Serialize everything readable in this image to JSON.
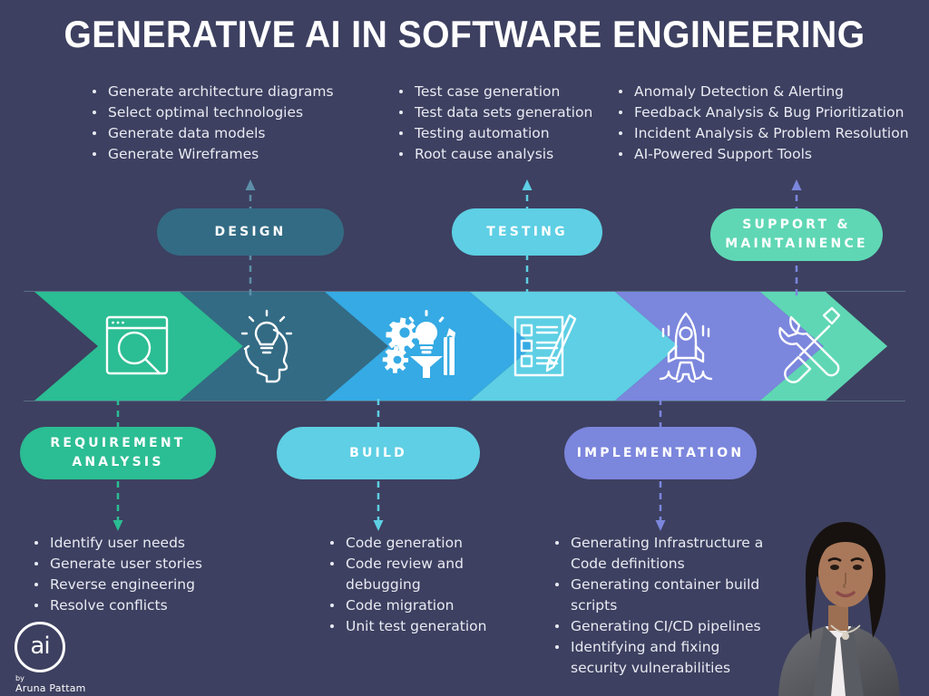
{
  "title": "GENERATIVE AI IN SOFTWARE ENGINEERING",
  "colors": {
    "background": "#3d4060",
    "requirement": "#2bbd93",
    "design": "#336b84",
    "build": "#35aae4",
    "testing": "#5ecfe4",
    "implementation": "#7b86dd",
    "support": "#5fd7b4",
    "text": "#e9eaf2"
  },
  "top_lists": [
    {
      "stage": "DESIGN",
      "items": [
        "Generate architecture diagrams",
        "Select optimal technologies",
        "Generate data models",
        "Generate Wireframes"
      ]
    },
    {
      "stage": "TESTING",
      "items": [
        "Test case generation",
        "Test data sets generation",
        "Testing automation",
        "Root cause analysis"
      ]
    },
    {
      "stage": "SUPPORT & MAINTAINENCE",
      "items": [
        "Anomaly Detection & Alerting",
        "Feedback Analysis & Bug Prioritization",
        "Incident Analysis & Problem Resolution",
        "AI-Powered Support Tools"
      ]
    }
  ],
  "bottom_lists": [
    {
      "stage": "REQUIREMENT ANALYSIS",
      "items": [
        "Identify user needs",
        "Generate user stories",
        "Reverse engineering",
        "Resolve conflicts"
      ]
    },
    {
      "stage": "BUILD",
      "items": [
        "Code generation",
        "Code review and debugging",
        "Code migration",
        "Unit test generation"
      ]
    },
    {
      "stage": "IMPLEMENTATION",
      "items": [
        "Generating Infrastructure as Code definitions",
        "Generating container build scripts",
        "Generating CI/CD pipelines",
        "Identifying and fixing security vulnerabilities"
      ]
    }
  ],
  "pills": {
    "design": "DESIGN",
    "testing": "TESTING",
    "support": "SUPPORT &\nMAINTAINENCE",
    "requirement": "REQUIREMENT\nANALYSIS",
    "build": "BUILD",
    "implementation": "IMPLEMENTATION"
  },
  "chevrons": [
    {
      "stage": "REQUIREMENT ANALYSIS",
      "icon": "browser-search-icon",
      "color": "#2bbd93"
    },
    {
      "stage": "DESIGN",
      "icon": "lightbulb-head-icon",
      "color": "#336b84"
    },
    {
      "stage": "BUILD",
      "icon": "gears-pencil-icon",
      "color": "#35aae4"
    },
    {
      "stage": "TESTING",
      "icon": "checklist-pencil-icon",
      "color": "#5ecfe4"
    },
    {
      "stage": "IMPLEMENTATION",
      "icon": "rocket-icon",
      "color": "#7b86dd"
    },
    {
      "stage": "SUPPORT & MAINTAINENCE",
      "icon": "wrench-screwdriver-icon",
      "color": "#5fd7b4"
    }
  ],
  "logo": {
    "mark": "ai",
    "by": "by",
    "name": "Aruna Pattam"
  }
}
